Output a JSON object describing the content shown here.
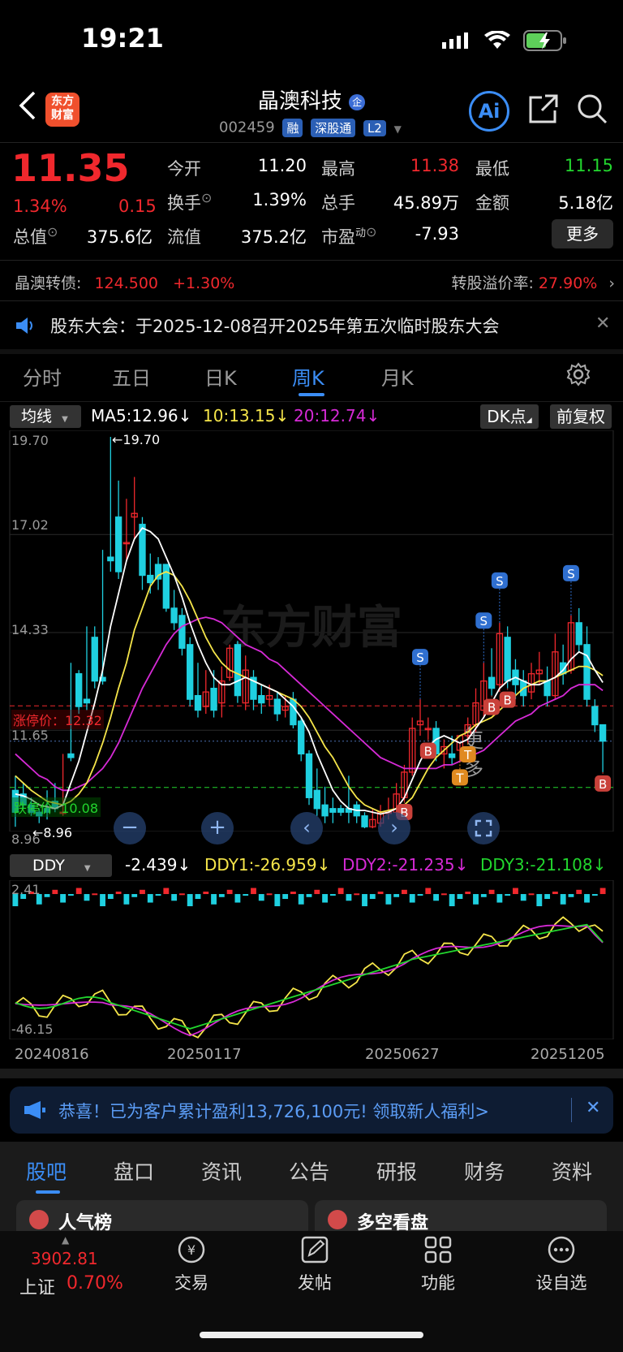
{
  "status": {
    "time": "19:21"
  },
  "header": {
    "logo_text": "东方\n财富",
    "title": "晶澳科技",
    "title_badge": "企",
    "code": "002459",
    "tags": [
      "融",
      "深股通",
      "L2"
    ],
    "ai_label": "Ai"
  },
  "quote": {
    "price": "11.35",
    "change_pct": "1.34%",
    "change": "0.15",
    "fields": [
      {
        "label": "今开",
        "value": "11.20",
        "color": "white"
      },
      {
        "label": "最高",
        "value": "11.38",
        "color": "red"
      },
      {
        "label": "最低",
        "value": "11.15",
        "color": "green"
      },
      {
        "label": "换手",
        "value": "1.39%",
        "color": "white"
      },
      {
        "label": "总手",
        "value": "45.89万",
        "color": "white"
      },
      {
        "label": "金额",
        "value": "5.18亿",
        "color": "white"
      },
      {
        "label": "总值",
        "value": "375.6亿",
        "color": "white"
      },
      {
        "label": "流值",
        "value": "375.2亿",
        "color": "white"
      },
      {
        "label": "市盈",
        "label_sup": "动",
        "value": "-7.93",
        "color": "white"
      }
    ],
    "more_button": "更多"
  },
  "convertible": {
    "label": "晶澳转债:",
    "price": "124.500",
    "change": "+1.30%",
    "premium_label": "转股溢价率:",
    "premium_value": "27.90%"
  },
  "notice": {
    "text": "股东大会：于2025-12-08召开2025年第五次临时股东大会"
  },
  "chart_tabs": [
    "分时",
    "五日",
    "日K",
    "周K",
    "月K",
    "更多"
  ],
  "active_tab": "周K",
  "ma_bar": {
    "selector": "均线",
    "ma5": "MA5:12.96",
    "ma10": "10:13.15",
    "ma20": "20:12.74",
    "dk_button": "DK点",
    "adjust_button": "前复权"
  },
  "colors": {
    "up": "#f0282d",
    "down": "#1fd0e0",
    "ma5": "#ffffff",
    "ma10": "#f5e54a",
    "ma20": "#d62ad6",
    "accent": "#3b8df5"
  },
  "chart_data": {
    "type": "candlestick",
    "y_ticks": [
      "19.70",
      "17.02",
      "14.33",
      "11.65",
      "8.96"
    ],
    "annotations": {
      "high_label": "←19.70",
      "low_label": "←8.96",
      "limit_up": "涨停价：12.32",
      "limit_down": "跌停价",
      "limit_down_value": "10.08"
    },
    "candles": [
      [
        10.0,
        10.4,
        9.4,
        9.0
      ],
      [
        9.9,
        10.2,
        9.6,
        9.5
      ],
      [
        9.6,
        9.8,
        9.4,
        9.3
      ],
      [
        9.4,
        9.5,
        9.3,
        9.1
      ],
      [
        9.5,
        10.0,
        9.4,
        9.2
      ],
      [
        9.7,
        10.2,
        9.5,
        9.4
      ],
      [
        9.4,
        11.0,
        9.4,
        9.3
      ],
      [
        11.0,
        13.5,
        10.9,
        10.8
      ],
      [
        13.2,
        13.3,
        12.3,
        12.1
      ],
      [
        12.5,
        14.5,
        12.4,
        12.2
      ],
      [
        14.2,
        14.5,
        13.0,
        12.8
      ],
      [
        13.1,
        16.6,
        13.0,
        12.9
      ],
      [
        16.4,
        19.7,
        16.3,
        16.0
      ],
      [
        17.5,
        18.5,
        16.0,
        15.8
      ],
      [
        16.8,
        18.0,
        16.8,
        16.3
      ],
      [
        17.5,
        18.6,
        17.6,
        16.9
      ],
      [
        17.3,
        17.5,
        15.9,
        15.5
      ],
      [
        15.9,
        16.5,
        15.7,
        15.4
      ],
      [
        16.2,
        16.4,
        15.8,
        15.5
      ],
      [
        16.2,
        16.2,
        15.0,
        14.9
      ],
      [
        15.0,
        15.5,
        14.6,
        14.4
      ],
      [
        14.8,
        15.0,
        13.9,
        13.7
      ],
      [
        14.0,
        14.2,
        12.5,
        12.3
      ],
      [
        12.6,
        13.5,
        12.2,
        12.0
      ],
      [
        12.3,
        13.3,
        12.7,
        12.1
      ],
      [
        12.8,
        13.3,
        12.2,
        12.0
      ],
      [
        12.4,
        13.4,
        13.0,
        12.0
      ],
      [
        13.1,
        14.0,
        13.9,
        13.0
      ],
      [
        14.0,
        14.1,
        12.6,
        12.4
      ],
      [
        12.4,
        13.7,
        13.3,
        12.2
      ],
      [
        13.1,
        13.3,
        12.5,
        12.2
      ],
      [
        12.6,
        12.9,
        12.4,
        12.1
      ],
      [
        12.5,
        12.9,
        12.6,
        12.3
      ],
      [
        12.5,
        12.7,
        12.1,
        11.9
      ],
      [
        12.2,
        12.6,
        12.3,
        12.0
      ],
      [
        12.5,
        12.7,
        11.8,
        11.7
      ],
      [
        11.9,
        12.0,
        11.0,
        10.8
      ],
      [
        11.0,
        11.1,
        9.8,
        9.6
      ],
      [
        10.0,
        10.6,
        9.5,
        9.3
      ],
      [
        9.6,
        10.1,
        9.3,
        9.1
      ],
      [
        9.5,
        9.8,
        9.4,
        9.1
      ],
      [
        9.5,
        9.6,
        9.4,
        9.3
      ],
      [
        9.5,
        10.4,
        9.4,
        9.1
      ],
      [
        9.6,
        9.7,
        9.3,
        9.1
      ],
      [
        9.3,
        9.4,
        9.0,
        8.96
      ],
      [
        9.0,
        9.5,
        9.2,
        8.96
      ],
      [
        9.1,
        9.6,
        9.4,
        9.0
      ],
      [
        9.4,
        9.8,
        9.4,
        9.2
      ],
      [
        9.4,
        10.2,
        9.9,
        9.3
      ],
      [
        9.8,
        10.7,
        10.5,
        9.7
      ],
      [
        10.5,
        12.0,
        11.7,
        10.4
      ],
      [
        11.8,
        12.5,
        11.9,
        11.5
      ],
      [
        11.7,
        12.0,
        11.7,
        11.4
      ],
      [
        11.7,
        11.9,
        11.0,
        10.8
      ],
      [
        11.0,
        11.4,
        11.2,
        10.6
      ],
      [
        11.0,
        11.5,
        10.9,
        10.7
      ],
      [
        11.1,
        11.3,
        11.5,
        10.8
      ],
      [
        11.5,
        12.0,
        11.8,
        11.3
      ],
      [
        11.8,
        12.8,
        12.4,
        11.6
      ],
      [
        12.2,
        13.5,
        13.0,
        12.0
      ],
      [
        13.1,
        13.9,
        12.8,
        12.6
      ],
      [
        12.9,
        14.6,
        14.3,
        12.7
      ],
      [
        14.2,
        14.5,
        13.0,
        12.8
      ],
      [
        13.3,
        13.6,
        12.9,
        12.5
      ],
      [
        13.0,
        13.3,
        12.6,
        12.3
      ],
      [
        12.7,
        13.5,
        13.2,
        12.5
      ],
      [
        13.2,
        13.8,
        13.3,
        12.9
      ],
      [
        13.0,
        13.4,
        12.6,
        12.3
      ],
      [
        12.6,
        14.3,
        13.8,
        12.5
      ],
      [
        13.5,
        14.0,
        13.2,
        12.9
      ],
      [
        13.3,
        14.8,
        14.6,
        13.2
      ],
      [
        14.6,
        15.0,
        14.0,
        13.8
      ],
      [
        14.0,
        14.5,
        12.5,
        12.3
      ],
      [
        12.3,
        12.5,
        11.8,
        11.6
      ],
      [
        11.8,
        11.8,
        11.35,
        10.5
      ]
    ],
    "ma5": [
      9.9,
      9.85,
      9.75,
      9.6,
      9.55,
      9.5,
      9.6,
      10.2,
      10.8,
      11.6,
      12.4,
      13.3,
      14.5,
      15.4,
      16.3,
      16.9,
      17.2,
      17.1,
      16.9,
      16.4,
      15.9,
      15.3,
      14.6,
      14.0,
      13.5,
      13.1,
      12.9,
      12.9,
      13.0,
      13.1,
      13.0,
      12.9,
      12.8,
      12.7,
      12.5,
      12.3,
      12.0,
      11.6,
      11.0,
      10.5,
      10.0,
      9.7,
      9.5,
      9.45,
      9.45,
      9.4,
      9.35,
      9.4,
      9.5,
      9.8,
      10.3,
      10.8,
      11.2,
      11.4,
      11.5,
      11.4,
      11.3,
      11.4,
      11.7,
      12.0,
      12.4,
      12.8,
      13.0,
      13.1,
      13.0,
      12.9,
      12.9,
      13.0,
      13.1,
      13.3,
      13.6,
      13.8,
      13.7,
      13.3,
      12.96
    ],
    "ma10": [
      10.4,
      10.2,
      10.0,
      9.85,
      9.7,
      9.65,
      9.6,
      9.7,
      9.9,
      10.2,
      10.7,
      11.3,
      12.0,
      12.8,
      13.5,
      14.4,
      15.0,
      15.6,
      15.9,
      16.0,
      15.9,
      15.6,
      15.2,
      14.7,
      14.2,
      13.8,
      13.5,
      13.3,
      13.2,
      13.1,
      13.0,
      12.9,
      12.8,
      12.7,
      12.6,
      12.5,
      12.3,
      12.0,
      11.6,
      11.2,
      10.9,
      10.5,
      10.1,
      9.8,
      9.6,
      9.5,
      9.4,
      9.45,
      9.5,
      9.6,
      9.8,
      10.2,
      10.6,
      10.9,
      11.1,
      11.3,
      11.5,
      11.6,
      11.8,
      11.9,
      12.0,
      12.2,
      12.4,
      12.6,
      12.8,
      12.9,
      13.0,
      13.0,
      13.1,
      13.2,
      13.3,
      13.4,
      13.4,
      13.3,
      13.15
    ],
    "ma20": [
      11.0,
      10.8,
      10.6,
      10.4,
      10.3,
      10.1,
      10.0,
      10.0,
      10.1,
      10.2,
      10.4,
      10.6,
      10.9,
      11.3,
      11.8,
      12.3,
      12.8,
      13.2,
      13.6,
      14.0,
      14.3,
      14.5,
      14.6,
      14.7,
      14.75,
      14.7,
      14.6,
      14.4,
      14.2,
      14.0,
      13.9,
      13.8,
      13.6,
      13.5,
      13.3,
      13.1,
      12.9,
      12.7,
      12.5,
      12.3,
      12.1,
      11.9,
      11.7,
      11.5,
      11.3,
      11.1,
      10.9,
      10.8,
      10.7,
      10.6,
      10.6,
      10.6,
      10.6,
      10.6,
      10.7,
      10.7,
      10.8,
      10.9,
      11.0,
      11.1,
      11.3,
      11.5,
      11.7,
      11.9,
      12.0,
      12.1,
      12.3,
      12.4,
      12.5,
      12.6,
      12.8,
      12.9,
      12.9,
      12.9,
      12.74
    ],
    "signals": [
      {
        "label": "B",
        "i": 49
      },
      {
        "label": "S",
        "i": 51
      },
      {
        "label": "B",
        "i": 52
      },
      {
        "label": "T",
        "i": 56
      },
      {
        "label": "T",
        "i": 57
      },
      {
        "label": "S",
        "i": 59
      },
      {
        "label": "B",
        "i": 60
      },
      {
        "label": "S",
        "i": 61
      },
      {
        "label": "B",
        "i": 62
      },
      {
        "label": "S",
        "i": 70
      },
      {
        "label": "B",
        "i": 74
      }
    ],
    "x_labels": [
      "20240816",
      "20250117",
      "20250627",
      "20251205"
    ]
  },
  "ddy": {
    "selector": "DDY",
    "value": "-2.439",
    "ddy1": "DDY1:-26.959",
    "ddy2": "DDY2:-21.235",
    "ddy3": "DDY3:-21.108",
    "y_top": "2.41",
    "y_bottom": "-46.15"
  },
  "promo": {
    "text": "恭喜！已为客户累计盈利13,726,100元! 领取新人福利>"
  },
  "bottom_tabs": [
    "股吧",
    "盘口",
    "资讯",
    "公告",
    "研报",
    "财务",
    "资料"
  ],
  "cards": [
    {
      "label": "人气榜"
    },
    {
      "label": "多空看盘"
    }
  ],
  "index": {
    "value": "3902.81",
    "name": "上证",
    "change": "0.70%"
  },
  "nav": [
    "交易",
    "发帖",
    "功能",
    "设自选"
  ]
}
